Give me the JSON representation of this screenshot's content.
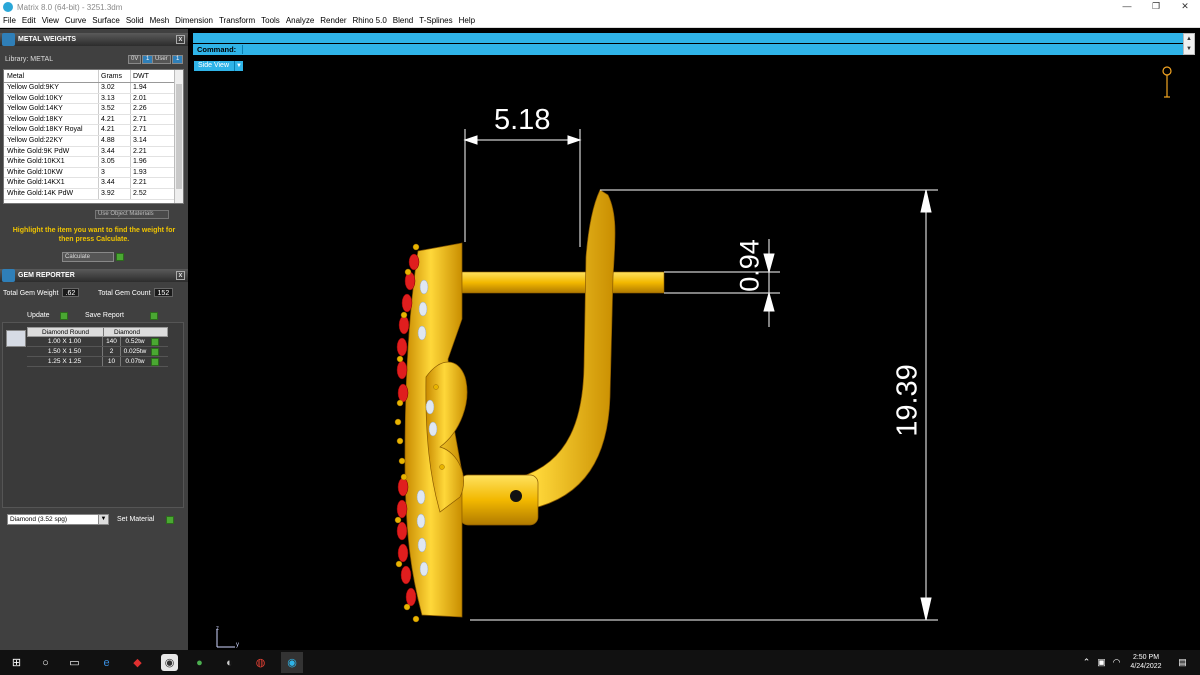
{
  "window": {
    "title": "Matrix 8.0 (64-bit) - 3251.3dm",
    "minimize": "—",
    "maximize": "❐",
    "close": "✕"
  },
  "menu": [
    "File",
    "Edit",
    "View",
    "Curve",
    "Surface",
    "Solid",
    "Mesh",
    "Dimension",
    "Transform",
    "Tools",
    "Analyze",
    "Render",
    "Rhino 5.0",
    "Blend",
    "T-Splines",
    "Help"
  ],
  "metal_weights": {
    "title": "METAL WEIGHTS",
    "close": "x",
    "library_label": "Library: METAL",
    "btn_0v": "0V",
    "btn_user": "User",
    "btn_1a": "1",
    "btn_1b": "1",
    "columns": [
      "Metal",
      "Grams",
      "DWT"
    ],
    "rows": [
      [
        "Yellow Gold:9KY",
        "3.02",
        "1.94"
      ],
      [
        "Yellow Gold:10KY",
        "3.13",
        "2.01"
      ],
      [
        "Yellow Gold:14KY",
        "3.52",
        "2.26"
      ],
      [
        "Yellow Gold:18KY",
        "4.21",
        "2.71"
      ],
      [
        "Yellow Gold:18KY Royal",
        "4.21",
        "2.71"
      ],
      [
        "Yellow Gold:22KY",
        "4.88",
        "3.14"
      ],
      [
        "White Gold:9K PdW",
        "3.44",
        "2.21"
      ],
      [
        "White Gold:10KX1",
        "3.05",
        "1.96"
      ],
      [
        "White Gold:10KW",
        "3",
        "1.93"
      ],
      [
        "White Gold:14KX1",
        "3.44",
        "2.21"
      ],
      [
        "White Gold:14K PdW",
        "3.92",
        "2.52"
      ]
    ],
    "use_object_materials": "Use Object Materials",
    "hint": "Highlight the item you want to find the weight for then press Calculate.",
    "calculate": "Calculate"
  },
  "gem_reporter": {
    "title": "GEM REPORTER",
    "close": "x",
    "total_gem_weight_label": "Total Gem Weight",
    "total_gem_weight": ".62",
    "total_gem_count_label": "Total Gem Count",
    "total_gem_count": "152",
    "update": "Update",
    "save_report": "Save Report",
    "columns": [
      "Diamond Round",
      "Diamond"
    ],
    "rows": [
      [
        "1.00 X 1.00",
        "140",
        "0.52tw"
      ],
      [
        "1.50 X 1.50",
        "2",
        "0.025tw"
      ],
      [
        "1.25 X 1.25",
        "10",
        "0.07tw"
      ]
    ],
    "material_select": "Diamond    (3.52 spg)",
    "set_material": "Set Material"
  },
  "command": {
    "label": "Command:",
    "value": ""
  },
  "viewport": {
    "view_name": "Side View",
    "axis_z": "z",
    "axis_y": "y"
  },
  "dimensions": {
    "top_width": "5.18",
    "post_diameter": "0.94",
    "height": "19.39"
  },
  "taskbar": {
    "time": "2:50 PM",
    "date": "4/24/2022"
  },
  "colors": {
    "gold": "#f5c518",
    "ruby": "#e01e1e",
    "accent": "#2fb4e8"
  }
}
